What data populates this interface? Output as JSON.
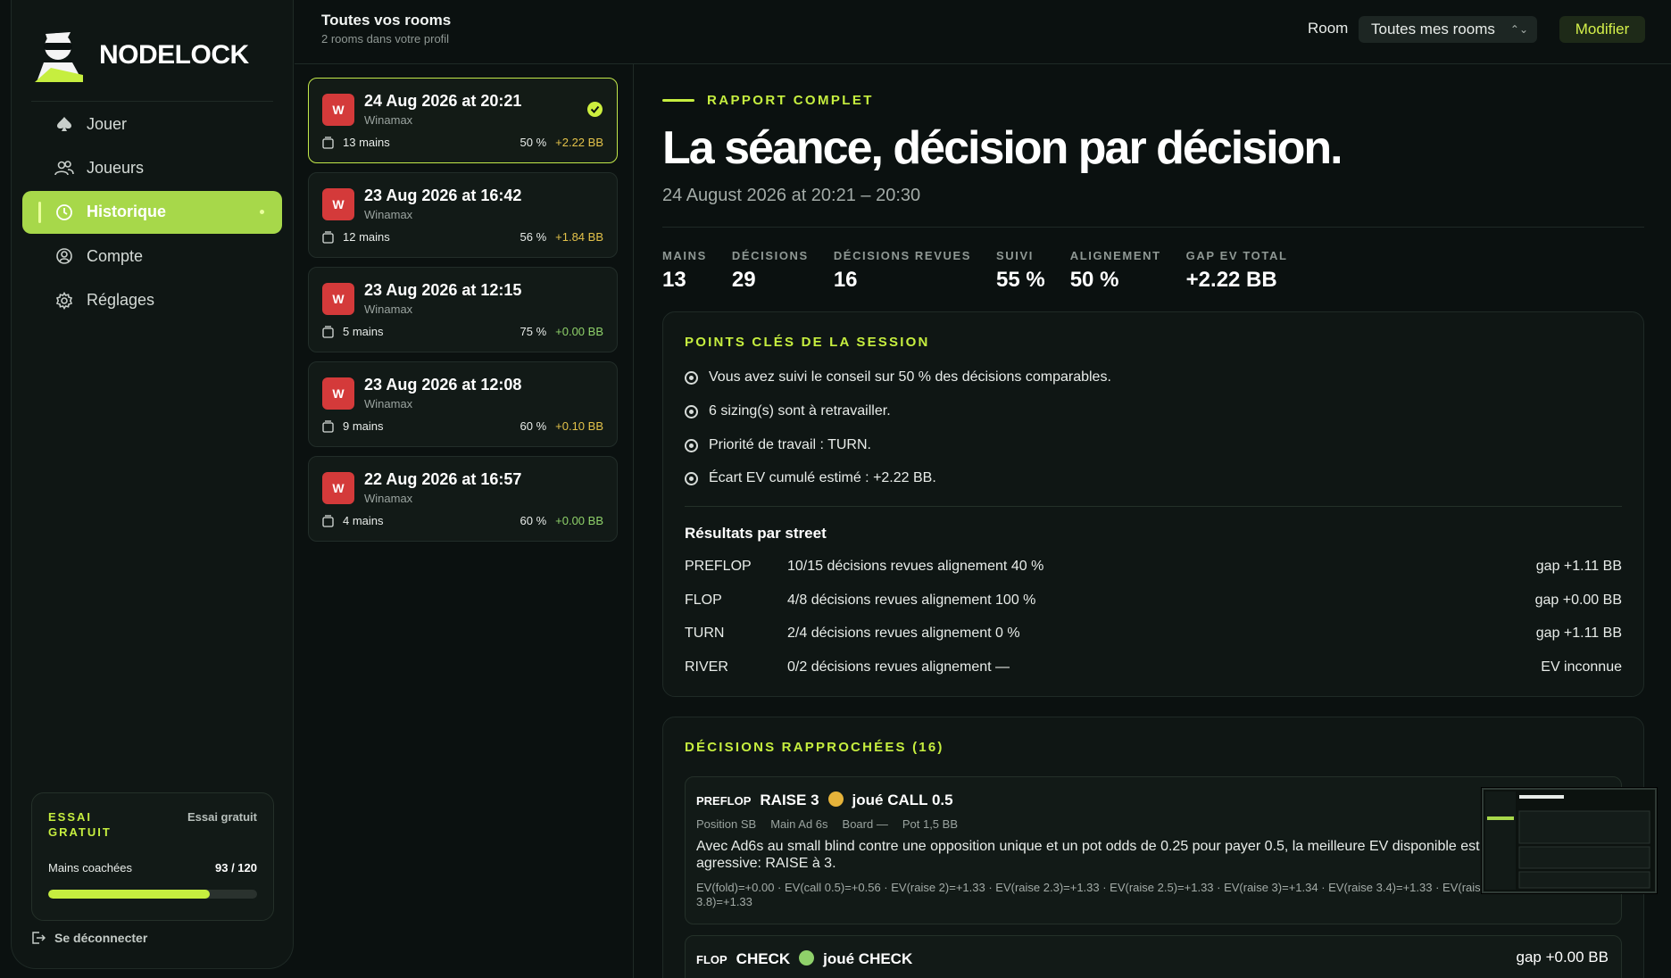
{
  "brand": {
    "name": "NODELOCK"
  },
  "nav": [
    {
      "label": "Jouer",
      "icon": "spade-icon"
    },
    {
      "label": "Joueurs",
      "icon": "users-icon"
    },
    {
      "label": "Historique",
      "icon": "history-icon",
      "active": true
    },
    {
      "label": "Compte",
      "icon": "user-circle-icon"
    },
    {
      "label": "Réglages",
      "icon": "gear-icon"
    }
  ],
  "trial": {
    "tag": "ESSAI GRATUIT",
    "right_label": "Essai gratuit",
    "hands_label": "Mains coachées",
    "hands_value": "93 / 120",
    "progress": 0.775
  },
  "logout": {
    "label": "Se déconnecter"
  },
  "topbar": {
    "title": "Toutes vos rooms",
    "subtitle": "2 rooms dans votre profil",
    "room_label": "Room",
    "room_value": "Toutes mes rooms",
    "modify_label": "Modifier"
  },
  "sessions": [
    {
      "badge": "W",
      "title": "24 Aug 2026 at 20:21",
      "room": "Winamax",
      "hands": "13 mains",
      "pct": "50 %",
      "gap": "+2.22 BB",
      "selected": true
    },
    {
      "badge": "W",
      "title": "23 Aug 2026 at 16:42",
      "room": "Winamax",
      "hands": "12 mains",
      "pct": "56 %",
      "gap": "+1.84 BB"
    },
    {
      "badge": "W",
      "title": "23 Aug 2026 at 12:15",
      "room": "Winamax",
      "hands": "5 mains",
      "pct": "75 %",
      "gap": "+0.00 BB"
    },
    {
      "badge": "W",
      "title": "23 Aug 2026 at 12:08",
      "room": "Winamax",
      "hands": "9 mains",
      "pct": "60 %",
      "gap": "+0.10 BB"
    },
    {
      "badge": "W",
      "title": "22 Aug 2026 at 16:57",
      "room": "Winamax",
      "hands": "4 mains",
      "pct": "60 %",
      "gap": "+0.00 BB"
    }
  ],
  "report": {
    "kicker": "RAPPORT COMPLET",
    "title": "La séance, décision par décision.",
    "subtitle": "24 August 2026 at 20:21 – 20:30",
    "stats": [
      {
        "k": "MAINS",
        "v": "13"
      },
      {
        "k": "DÉCISIONS",
        "v": "29"
      },
      {
        "k": "DÉCISIONS REVUES",
        "v": "16"
      },
      {
        "k": "SUIVI",
        "v": "55 %"
      },
      {
        "k": "ALIGNEMENT",
        "v": "50 %"
      },
      {
        "k": "GAP EV TOTAL",
        "v": "+2.22 BB"
      }
    ]
  },
  "keypoints": {
    "header": "POINTS CLÉS DE LA SESSION",
    "items": [
      "Vous avez suivi le conseil sur 50 % des décisions comparables.",
      "6 sizing(s) sont à retravailler.",
      "Priorité de travail : TURN.",
      "Écart EV cumulé estimé : +2.22 BB."
    ],
    "results_header": "Résultats par street",
    "streets": [
      {
        "street": "PREFLOP",
        "review": "10/15 décisions revues  alignement 40 %",
        "gap": "gap +1.11 BB"
      },
      {
        "street": "FLOP",
        "review": "4/8 décisions revues  alignement 100 %",
        "gap": "gap +0.00 BB"
      },
      {
        "street": "TURN",
        "review": "2/4 décisions revues  alignement 0 %",
        "gap": "gap +1.11 BB"
      },
      {
        "street": "RIVER",
        "review": "0/2 décisions revues  alignement —",
        "gap": "EV inconnue"
      }
    ]
  },
  "decisions": {
    "header": "DÉCISIONS RAPPROCHÉES (16)",
    "items": [
      {
        "street": "PREFLOP",
        "action": "RAISE 3",
        "played": "joué CALL 0.5",
        "position": "Position SB",
        "hand": "Main Ad 6s",
        "board": "Board —",
        "pot": "Pot 1,5 BB",
        "text": "Avec Ad6s au small blind contre une opposition unique et un pot odds de 0.25 pour payer 0.5, la meilleure EV disponible est agressive: RAISE à 3.",
        "ev": "EV(fold)=+0.00 · EV(call 0.5)=+0.56 · EV(raise 2)=+1.33 · EV(raise 2.3)=+1.33 · EV(raise 2.5)=+1.33 · EV(raise 3)=+1.34 · EV(raise 3.4)=+1.33 · EV(raise 3.8)=+1.33",
        "gap": "",
        "status_color": "#e6b33a"
      },
      {
        "street": "FLOP",
        "action": "CHECK",
        "played": "joué CHECK",
        "gap": "gap +0.00 BB",
        "status_color": "#8fd16a"
      }
    ]
  },
  "colors": {
    "accent": "#c6ee3f",
    "active_nav": "#a7d84a",
    "room_badge": "#d43a3a"
  }
}
